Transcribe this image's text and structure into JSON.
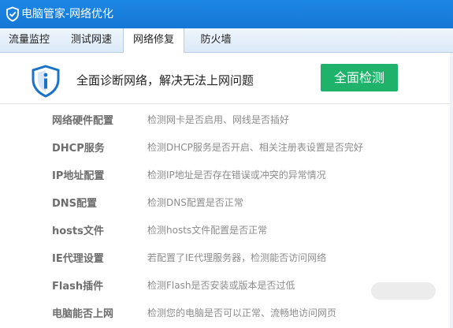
{
  "window": {
    "title": "电脑管家-网络优化",
    "title_icon": "shield-check-icon"
  },
  "tabs": [
    {
      "label": "流量监控",
      "active": false
    },
    {
      "label": "测试网速",
      "active": false
    },
    {
      "label": "网络修复",
      "active": true
    },
    {
      "label": "防火墙",
      "active": false
    }
  ],
  "header": {
    "icon": "shield-info-icon",
    "text": "全面诊断网络，解决无法上网问题",
    "button_label": "全面检测"
  },
  "items": [
    {
      "name": "网络硬件配置",
      "desc": "检测网卡是否启用、网线是否插好"
    },
    {
      "name": "DHCP服务",
      "desc": "检测DHCP服务是否开启、相关注册表设置是否完好"
    },
    {
      "name": "IP地址配置",
      "desc": "检测IP地址是否存在错误或冲突的异常情况"
    },
    {
      "name": "DNS配置",
      "desc": "检测DNS配置是否正常"
    },
    {
      "name": "hosts文件",
      "desc": "检测hosts文件配置是否正常"
    },
    {
      "name": "IE代理设置",
      "desc": "若配置了IE代理服务器，检测能否访问网络"
    },
    {
      "name": "Flash插件",
      "desc": "检测Flash是否安装或版本是否过低"
    },
    {
      "name": "电脑能否上网",
      "desc": "检测您的电脑是否可以正常、流畅地访问网页"
    }
  ],
  "colors": {
    "titlebar": "#1577d6",
    "accent_button": "#1fb26b",
    "shield": "#1a72c9"
  }
}
